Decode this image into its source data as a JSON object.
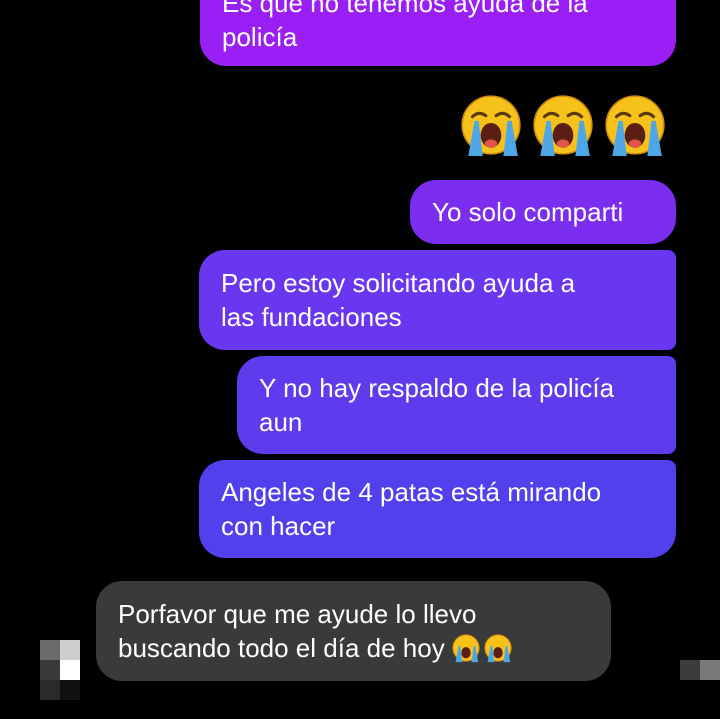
{
  "messages": [
    {
      "from": "me",
      "lines": [
        "Es que no tenemos ayuda de la",
        "policía"
      ]
    },
    {
      "from": "me",
      "emoji": [
        "crying-face",
        "crying-face",
        "crying-face"
      ]
    },
    {
      "from": "me",
      "lines": [
        "Yo solo comparti"
      ]
    },
    {
      "from": "me",
      "lines": [
        "Pero estoy solicitando ayuda a",
        "las fundaciones"
      ]
    },
    {
      "from": "me",
      "lines": [
        "Y no hay respaldo de la policía",
        "aun"
      ]
    },
    {
      "from": "me",
      "lines": [
        "Angeles de 4 patas está mirando",
        "con hacer"
      ]
    },
    {
      "from": "them",
      "lines": [
        "Porfavor que me ayude lo llevo",
        "buscando todo el día de hoy"
      ],
      "trailing_emoji": [
        "crying-face",
        "crying-face"
      ]
    }
  ],
  "colors": {
    "background": "#000000",
    "sent_top": "#9a1ff5",
    "sent_bottom": "#5140ec",
    "received": "#3a3a3a"
  },
  "icons": {
    "emoji": "loudly-crying-face",
    "avatar": "pixelated-avatar"
  }
}
